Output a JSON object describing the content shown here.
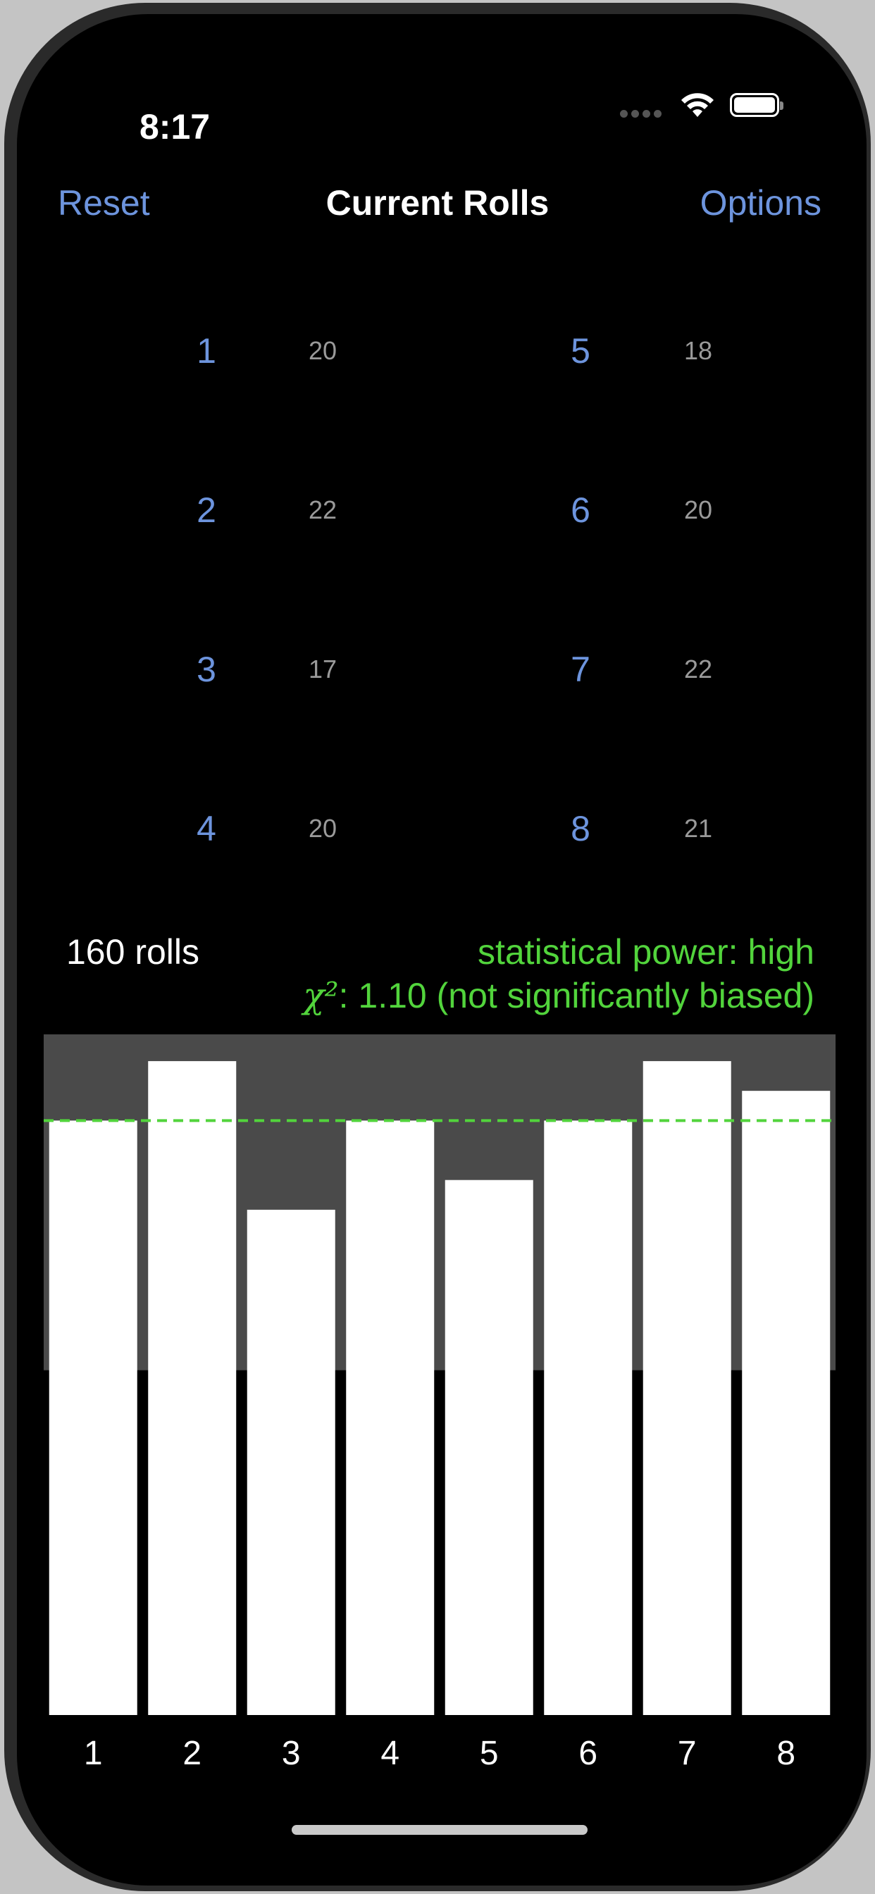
{
  "status_bar": {
    "time": "8:17"
  },
  "nav": {
    "left_button": "Reset",
    "title": "Current Rolls",
    "right_button": "Options"
  },
  "rolls": [
    {
      "face": "1",
      "count": "20"
    },
    {
      "face": "2",
      "count": "22"
    },
    {
      "face": "3",
      "count": "17"
    },
    {
      "face": "4",
      "count": "20"
    },
    {
      "face": "5",
      "count": "18"
    },
    {
      "face": "6",
      "count": "20"
    },
    {
      "face": "7",
      "count": "22"
    },
    {
      "face": "8",
      "count": "21"
    }
  ],
  "summary": {
    "total": "160 rolls",
    "power": "statistical power: high",
    "chi_symbol": "χ²",
    "chi_text": ": 1.10 (not significantly biased)"
  },
  "colors": {
    "accent": "#6d94dd",
    "significance": "#52d43c",
    "band": "#4a4a4a",
    "bar": "#ffffff"
  },
  "chart_data": {
    "type": "bar",
    "categories": [
      "1",
      "2",
      "3",
      "4",
      "5",
      "6",
      "7",
      "8"
    ],
    "values": [
      20,
      22,
      17,
      20,
      18,
      20,
      22,
      21
    ],
    "expected": 20,
    "ylim": [
      0,
      22.9
    ],
    "confidence_band": [
      11.6,
      22.9
    ],
    "grid": false
  }
}
